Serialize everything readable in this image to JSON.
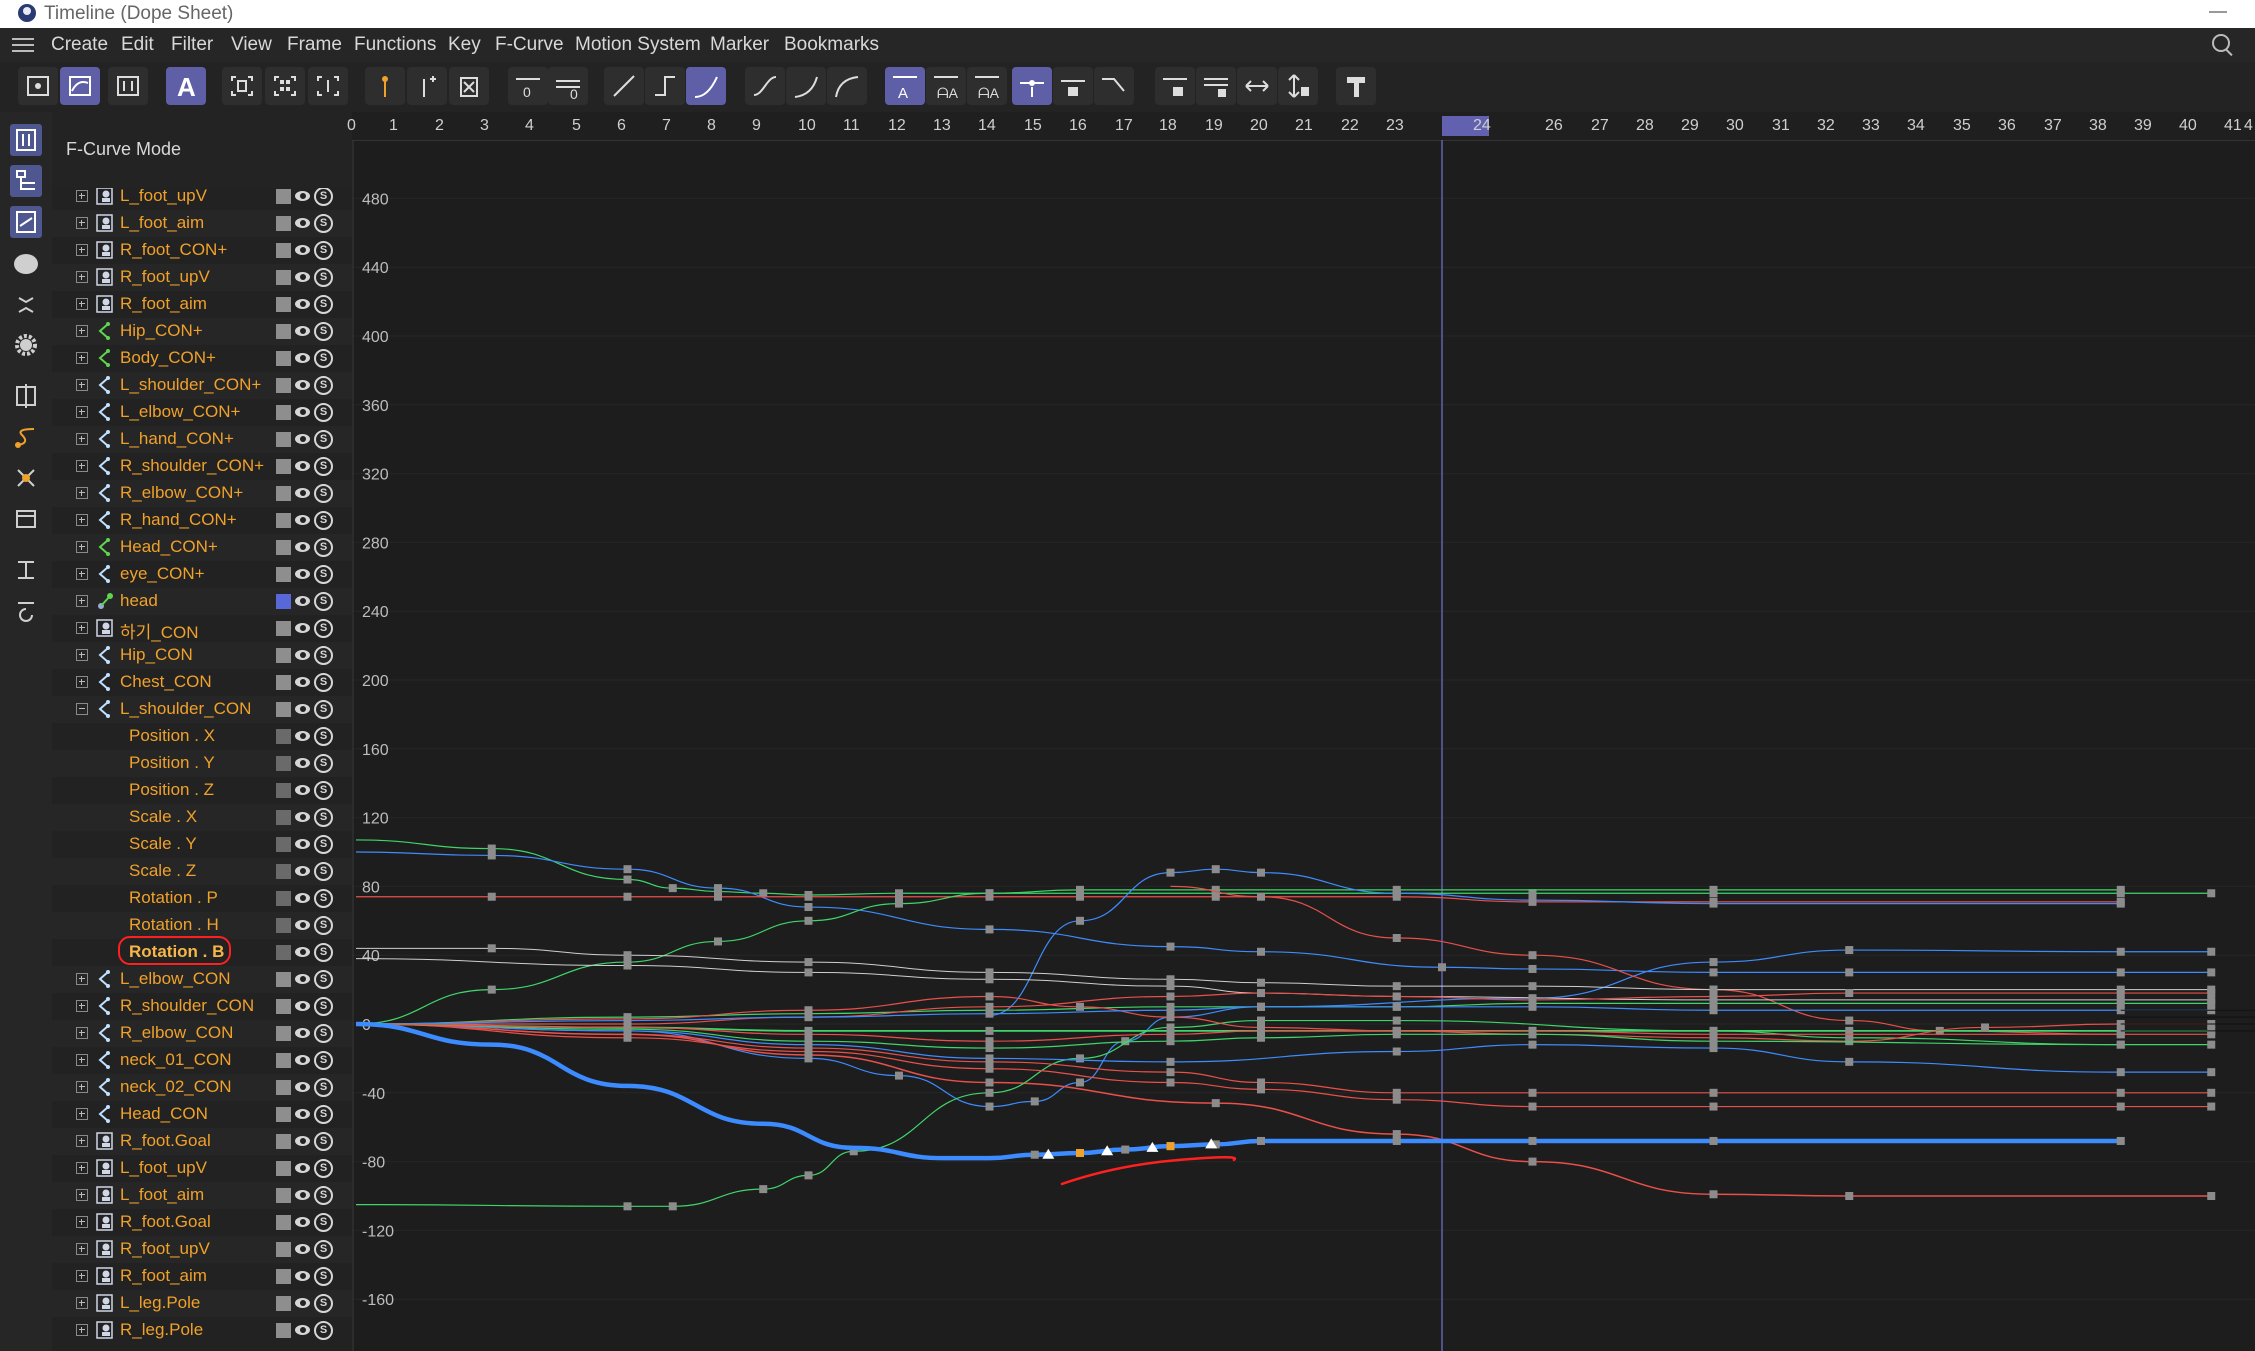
{
  "window": {
    "title": "Timeline (Dope Sheet)"
  },
  "menu": [
    "Create",
    "Edit",
    "Filter",
    "View",
    "Frame",
    "Functions",
    "Key",
    "F-Curve",
    "Motion System",
    "Marker",
    "Bookmarks"
  ],
  "mode_header": "F-Curve Mode",
  "ruler": {
    "current_frame": "24",
    "frames": [
      "0",
      "1",
      "2",
      "3",
      "4",
      "5",
      "6",
      "7",
      "8",
      "9",
      "10",
      "11",
      "12",
      "13",
      "14",
      "15",
      "16",
      "17",
      "18",
      "19",
      "20",
      "21",
      "22",
      "23",
      "24",
      "26",
      "27",
      "28",
      "29",
      "30",
      "31",
      "32",
      "33",
      "34",
      "35",
      "36",
      "37",
      "38",
      "39",
      "40",
      "41",
      "4"
    ]
  },
  "value_axis": [
    "480",
    "440",
    "400",
    "360",
    "320",
    "280",
    "240",
    "200",
    "160",
    "120",
    "80",
    "40",
    "0",
    "-40",
    "-80",
    "-120",
    "-160"
  ],
  "tree": [
    {
      "label": "L_foot_upV",
      "icon": "null-object-icon"
    },
    {
      "label": "L_foot_aim",
      "icon": "null-object-icon"
    },
    {
      "label": "R_foot_CON+",
      "icon": "null-object-icon"
    },
    {
      "label": "R_foot_upV",
      "icon": "null-object-icon"
    },
    {
      "label": "R_foot_aim",
      "icon": "null-object-icon"
    },
    {
      "label": "Hip_CON+",
      "icon": "spline-icon"
    },
    {
      "label": "Body_CON+",
      "icon": "spline-icon"
    },
    {
      "label": "L_shoulder_CON+",
      "icon": "spline-icon"
    },
    {
      "label": "L_elbow_CON+",
      "icon": "spline-icon"
    },
    {
      "label": "L_hand_CON+",
      "icon": "spline-icon"
    },
    {
      "label": "R_shoulder_CON+",
      "icon": "spline-icon"
    },
    {
      "label": "R_elbow_CON+",
      "icon": "spline-icon"
    },
    {
      "label": "R_hand_CON+",
      "icon": "spline-icon"
    },
    {
      "label": "Head_CON+",
      "icon": "spline-icon"
    },
    {
      "label": "eye_CON+",
      "icon": "spline-icon"
    },
    {
      "label": "head",
      "icon": "joint-icon"
    },
    {
      "label": "하기_CON",
      "icon": "null-object-icon"
    },
    {
      "label": "Hip_CON",
      "icon": "spline-icon"
    },
    {
      "label": "Chest_CON",
      "icon": "spline-icon"
    },
    {
      "label": "L_shoulder_CON",
      "icon": "spline-icon"
    },
    {
      "label": "Position . X",
      "icon": ""
    },
    {
      "label": "Position . Y",
      "icon": ""
    },
    {
      "label": "Position . Z",
      "icon": ""
    },
    {
      "label": "Scale . X",
      "icon": ""
    },
    {
      "label": "Scale . Y",
      "icon": ""
    },
    {
      "label": "Scale . Z",
      "icon": ""
    },
    {
      "label": "Rotation . P",
      "icon": ""
    },
    {
      "label": "Rotation . H",
      "icon": ""
    },
    {
      "label": "Rotation . B",
      "icon": ""
    },
    {
      "label": "L_elbow_CON",
      "icon": "spline-icon"
    },
    {
      "label": "R_shoulder_CON",
      "icon": "spline-icon"
    },
    {
      "label": "R_elbow_CON",
      "icon": "spline-icon"
    },
    {
      "label": "neck_01_CON",
      "icon": "spline-icon"
    },
    {
      "label": "neck_02_CON",
      "icon": "spline-icon"
    },
    {
      "label": "Head_CON",
      "icon": "spline-icon"
    },
    {
      "label": "R_foot.Goal",
      "icon": "null-object-icon"
    },
    {
      "label": "L_foot_upV",
      "icon": "null-object-icon"
    },
    {
      "label": "L_foot_aim",
      "icon": "null-object-icon"
    },
    {
      "label": "R_foot.Goal",
      "icon": "null-object-icon"
    },
    {
      "label": "R_foot_upV",
      "icon": "null-object-icon"
    },
    {
      "label": "R_foot_aim",
      "icon": "null-object-icon"
    },
    {
      "label": "L_leg.Pole",
      "icon": "null-object-icon"
    },
    {
      "label": "R_leg.Pole",
      "icon": "null-object-icon"
    }
  ],
  "selected_track": "Rotation . B",
  "colors": {
    "accent": "#5f5fa8",
    "item_text": "#f0a12a",
    "curve_blue": "#3d8cff",
    "curve_green": "#3fd56a",
    "curve_red": "#e8504a",
    "annotation": "#ff2020"
  }
}
